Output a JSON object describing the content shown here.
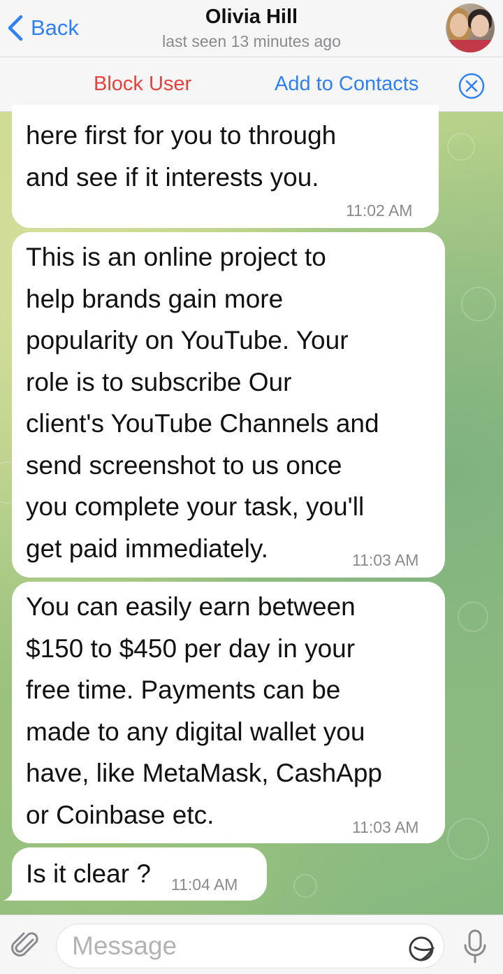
{
  "header": {
    "back_label": "Back",
    "contact_name": "Olivia Hill",
    "status": "last seen 13 minutes ago"
  },
  "action_bar": {
    "block_label": "Block User",
    "add_label": "Add to Contacts"
  },
  "messages": [
    {
      "text": "here first for you  to through\nand see if it interests you.",
      "time": "11:02 AM"
    },
    {
      "text": "This is an online project to\nhelp brands gain more\npopularity on YouTube. Your\nrole is to subscribe Our\nclient's YouTube Channels and\nsend screenshot to us once\nyou complete your task, you'll\nget paid immediately.",
      "time": "11:03 AM"
    },
    {
      "text": "You can easily earn between\n$150 to $450 per day in your\nfree time. Payments can be\nmade to any digital wallet you\nhave, like MetaMask, CashApp\nor Coinbase etc.",
      "time": "11:03 AM"
    },
    {
      "text": "Is it clear ?",
      "time": "11:04 AM"
    }
  ],
  "input": {
    "placeholder": "Message",
    "value": ""
  },
  "icons": {
    "back": "chevron-left-icon",
    "close": "close-circle-icon",
    "attach": "paperclip-icon",
    "sticker": "sticker-icon",
    "mic": "microphone-icon"
  },
  "colors": {
    "accent": "#2f7ff6",
    "danger": "#e5413d",
    "bubble": "#ffffff",
    "wallpaper": "#a9c98f"
  }
}
